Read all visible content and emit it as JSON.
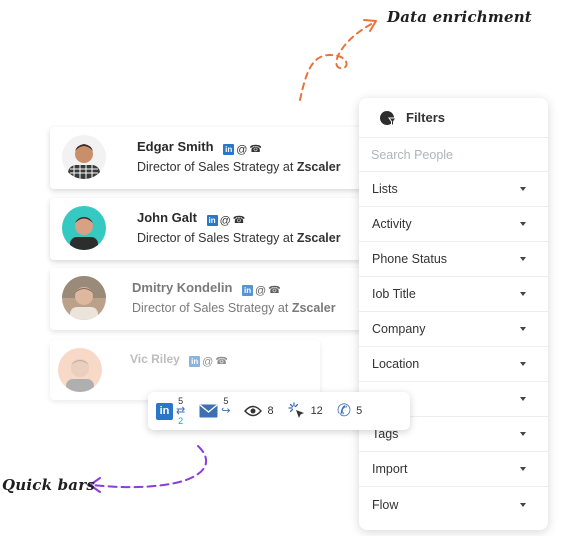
{
  "annotations": {
    "top": "Data enrichment",
    "bottom": "Quick bars"
  },
  "people": [
    {
      "name": "Edgar Smith",
      "title_prefix": "Director of Sales Strategy at",
      "company": "Zscaler"
    },
    {
      "name": "John Galt",
      "title_prefix": "Director of Sales Strategy at",
      "company": "Zscaler"
    },
    {
      "name": "Dmitry Kondelin",
      "title_prefix": "Director of Sales Strategy at",
      "company": "Zscaler"
    },
    {
      "name": "Vic Riley"
    }
  ],
  "contact_icons": {
    "linkedin": "in",
    "email": "@",
    "phone": "☎"
  },
  "filters": {
    "title": "Filters",
    "search_placeholder": "Search People",
    "items": [
      "Lists",
      "Activity",
      "Phone Status",
      "Iob Title",
      "Company",
      "Location",
      "ry",
      "Tags",
      "Import",
      "Flow"
    ]
  },
  "quickbar": {
    "linkedin": {
      "label": "in",
      "top": "5",
      "bottom": "2"
    },
    "email": {
      "top": "5"
    },
    "views": "8",
    "clicks": "12",
    "calls": "5"
  },
  "colors": {
    "linkedin": "#2977c9",
    "orange_arrow": "#e8743b",
    "purple_arrow": "#8a3ddb",
    "teal": "#1aa7b5"
  }
}
